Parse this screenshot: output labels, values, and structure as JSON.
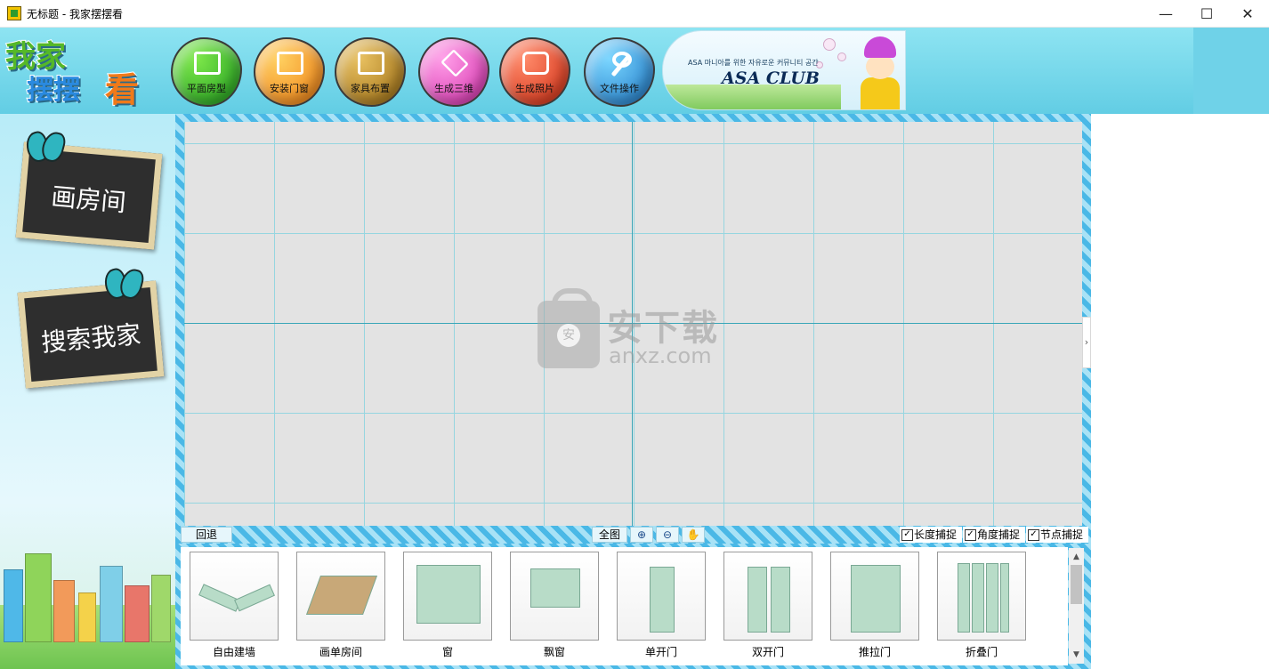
{
  "window": {
    "title": "无标题 - 我家摆摆看",
    "controls": {
      "minimize": "—",
      "maximize": "☐",
      "close": "✕"
    }
  },
  "logo": {
    "line1": "我家",
    "line2": "摆摆",
    "line3": "看"
  },
  "toolbar": {
    "items": [
      {
        "label": "平面房型",
        "icon": "floorplan-icon"
      },
      {
        "label": "安装门窗",
        "icon": "door-window-icon"
      },
      {
        "label": "家具布置",
        "icon": "furniture-icon"
      },
      {
        "label": "生成三维",
        "icon": "cube-icon"
      },
      {
        "label": "生成照片",
        "icon": "camera-icon"
      },
      {
        "label": "文件操作",
        "icon": "wrench-icon"
      }
    ]
  },
  "ad": {
    "tagline": "ASA 마니아를 위한 자유로운 커뮤니티 공간",
    "title": "ASA CLUB"
  },
  "sidebar": {
    "draw_room": "画房间",
    "search_home": "搜索我家"
  },
  "canvas": {
    "watermark": {
      "bag_char": "安",
      "title": "安下载",
      "url": "anxz.com"
    },
    "collapse_glyph": "›"
  },
  "strip": {
    "undo": "回退",
    "fit": "全图",
    "zoom_in_glyph": "⊕",
    "zoom_out_glyph": "⊖",
    "pan_glyph": "✋",
    "snaps": [
      {
        "label": "长度捕捉",
        "checked": true
      },
      {
        "label": "角度捕捉",
        "checked": true
      },
      {
        "label": "节点捕捉",
        "checked": true
      }
    ]
  },
  "palette": {
    "items": [
      {
        "label": "自由建墙"
      },
      {
        "label": "画单房间"
      },
      {
        "label": "窗"
      },
      {
        "label": "飘窗"
      },
      {
        "label": "单开门"
      },
      {
        "label": "双开门"
      },
      {
        "label": "推拉门"
      },
      {
        "label": "折叠门"
      }
    ],
    "scroll_up": "▲",
    "scroll_down": "▼"
  },
  "colors": {
    "banner": "#62cde4",
    "stripe_dark": "#4ab8e6",
    "stripe_light": "#a8e2f6",
    "canvas_bg": "#e3e3e3",
    "grid_line": "#96d6e0",
    "axis_line": "#3aa6b8"
  }
}
